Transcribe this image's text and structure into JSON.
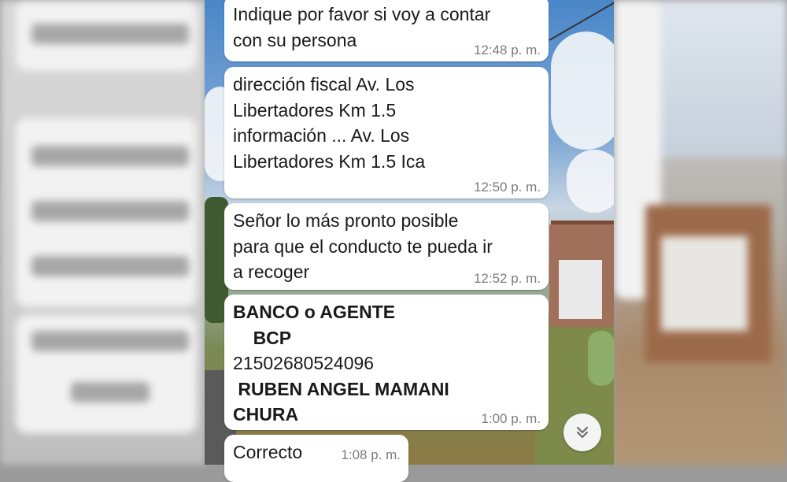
{
  "messages": [
    {
      "lines": [
        "Indique por favor si voy a contar",
        "con su persona"
      ],
      "time": "12:48 p. m."
    },
    {
      "lines": [
        "dirección fiscal Av. Los",
        "Libertadores Km 1.5",
        "información ... Av. Los",
        "Libertadores Km 1.5 Ica"
      ],
      "time": "12:50 p. m."
    },
    {
      "lines": [
        "Señor lo más pronto posible",
        "para que el conducto te pueda ir",
        "a recoger"
      ],
      "time": "12:52 p. m."
    },
    {
      "lines": [
        "BANCO o AGENTE",
        "    BCP",
        "21502680524096",
        " RUBEN ANGEL MAMANI",
        "CHURA"
      ],
      "time": "1:00 p. m."
    },
    {
      "lines": [
        "Correcto"
      ],
      "time": "1:08 p. m."
    }
  ],
  "scroll_button": {
    "icon": "double-chevron-down-icon"
  }
}
